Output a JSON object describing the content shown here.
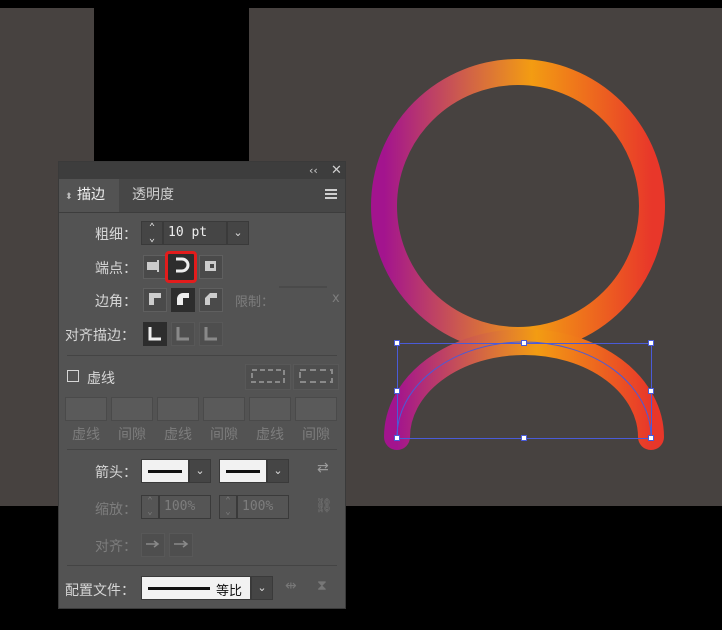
{
  "panel": {
    "tabs": [
      {
        "label": "描边",
        "active": true
      },
      {
        "label": "透明度",
        "active": false
      }
    ],
    "weight": {
      "label": "粗细：",
      "value": "10 pt"
    },
    "cap": {
      "label": "端点：",
      "selected": "round-cap"
    },
    "corner": {
      "label": "边角：",
      "limit_label": "限制：",
      "limit_unit": "x"
    },
    "align": {
      "label": "对齐描边："
    },
    "dashed": {
      "label": "虚线",
      "checked": false,
      "fields": [
        "虚线",
        "间隙",
        "虚线",
        "间隙",
        "虚线",
        "间隙"
      ]
    },
    "arrowheads": {
      "label": "箭头："
    },
    "scale": {
      "label": "缩放：",
      "start": "100%",
      "end": "100%"
    },
    "arrow_align": {
      "label": "对齐："
    },
    "profile": {
      "label": "配置文件：",
      "value": "等比"
    }
  },
  "colors": {
    "gradient_start": "#a3148e",
    "gradient_mid": "#f39c12",
    "gradient_end": "#e8372a",
    "highlight": "#e21c1c",
    "selection": "#4a5bd8"
  }
}
